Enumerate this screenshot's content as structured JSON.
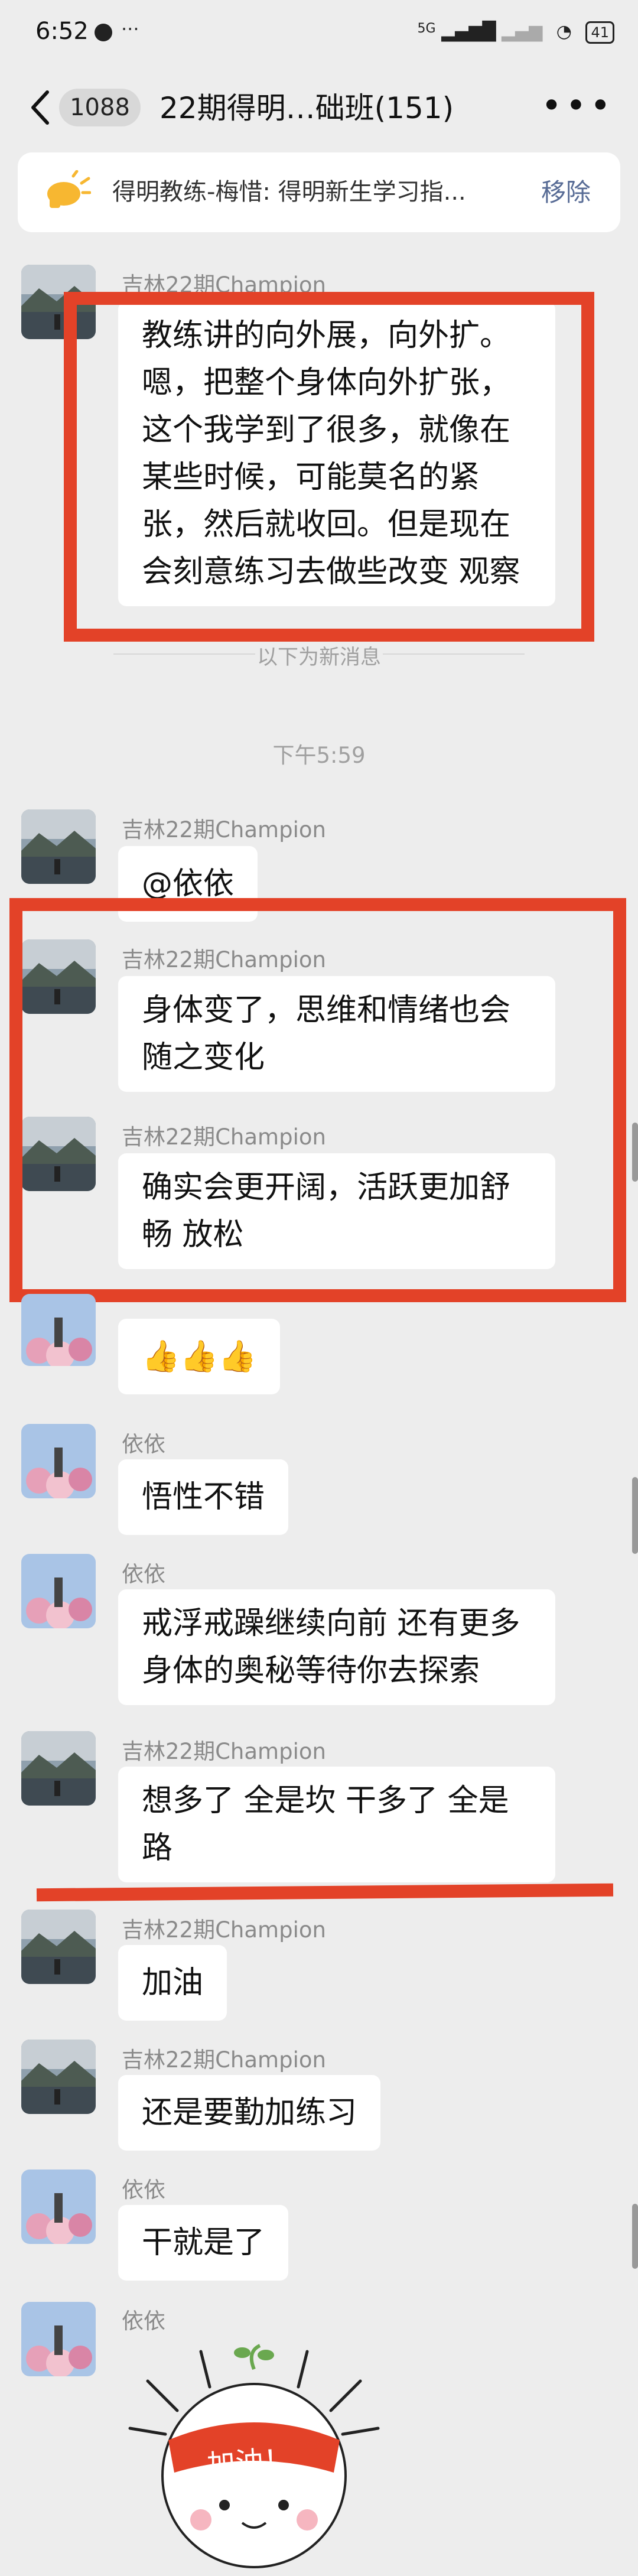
{
  "status_bar": {
    "time": "6:52",
    "network": "5G",
    "battery": "41"
  },
  "nav": {
    "unread_count": "1088",
    "title": "22期得明…础班(151)",
    "more": "•••"
  },
  "pinned": {
    "text": "得明教练-梅惜: 得明新生学习指...",
    "remove_label": "移除"
  },
  "divider_new": "以下为新消息",
  "time_marker": "下午5:59",
  "messages": [
    {
      "sender": "吉林22期Champion",
      "text": "教练讲的向外展，向外扩。嗯，把整个身体向外扩张，这个我学到了很多，就像在某些时候，可能莫名的紧张，然后就收回。但是现在会刻意练习去做些改变 观察",
      "avatar": "lake"
    },
    {
      "sender": "吉林22期Champion",
      "text": "@依依",
      "avatar": "lake"
    },
    {
      "sender": "吉林22期Champion",
      "text": "身体变了，思维和情绪也会随之变化",
      "avatar": "lake"
    },
    {
      "sender": "吉林22期Champion",
      "text": "确实会更开阔，活跃更加舒畅 放松",
      "avatar": "lake"
    },
    {
      "sender": "",
      "text": "👍👍👍",
      "avatar": "flowers"
    },
    {
      "sender": "依依",
      "text": "悟性不错",
      "avatar": "flowers"
    },
    {
      "sender": "依依",
      "text": "戒浮戒躁继续向前 还有更多身体的奥秘等待你去探索",
      "avatar": "flowers"
    },
    {
      "sender": "吉林22期Champion",
      "text": "想多了 全是坎 干多了 全是路",
      "avatar": "lake"
    },
    {
      "sender": "吉林22期Champion",
      "text": "加油",
      "avatar": "lake"
    },
    {
      "sender": "吉林22期Champion",
      "text": "还是要勤加练习",
      "avatar": "lake"
    },
    {
      "sender": "依依",
      "text": "干就是了",
      "avatar": "flowers"
    },
    {
      "sender": "依依",
      "text": "",
      "avatar": "flowers"
    }
  ],
  "sticker": {
    "text": "加油！"
  },
  "colors": {
    "annotation_red": "#e34228",
    "link_blue": "#576b95",
    "background": "#ededed"
  }
}
